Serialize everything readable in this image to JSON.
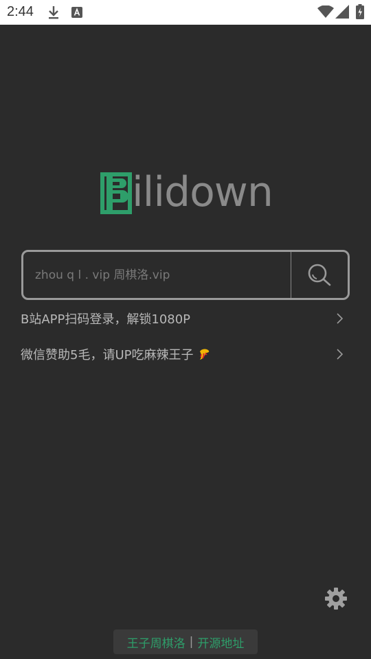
{
  "status_bar": {
    "time": "2:44",
    "icons": [
      "download-icon",
      "keyboard-a-icon",
      "wifi-icon",
      "signal-icon",
      "battery-charging-icon"
    ]
  },
  "logo": {
    "mark_letter": "B",
    "word": "ilidown",
    "brand_color": "#2e9e6a"
  },
  "search": {
    "placeholder": "zhou q l . vip 周棋洛.vip",
    "value": "",
    "button_icon": "search-icon"
  },
  "rows": [
    {
      "label": "B站APP扫码登录，解锁1080P",
      "icon": "chevron-right-icon"
    },
    {
      "label": "微信赞助5毛，请UP吃麻辣王子",
      "emoji": "🌶",
      "icon": "chevron-right-icon"
    }
  ],
  "settings": {
    "icon": "gear-icon"
  },
  "footer": {
    "author_link": "王子周棋洛",
    "separator": "|",
    "source_link": "开源地址"
  },
  "colors": {
    "background": "#2b2b2b",
    "brand_green": "#2e9e6a",
    "text_gray": "#b8b8b8"
  }
}
